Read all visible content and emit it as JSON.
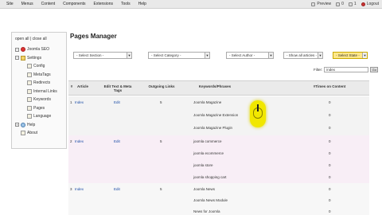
{
  "topbar": {
    "menu": [
      "Site",
      "Menus",
      "Content",
      "Components",
      "Extensions",
      "Tools",
      "Help"
    ],
    "preview": "Preview",
    "messages": "0",
    "users": "1",
    "logout": "Logout"
  },
  "sidebar": {
    "toggle": "open all | close all",
    "items": [
      {
        "label": "Joomla SEO"
      },
      {
        "label": "Settings"
      },
      {
        "label": "Config"
      },
      {
        "label": "MetaTags"
      },
      {
        "label": "Redirects"
      },
      {
        "label": "Internal Links"
      },
      {
        "label": "Keywords"
      },
      {
        "label": "Pages"
      },
      {
        "label": "Language"
      },
      {
        "label": "Help"
      },
      {
        "label": "About"
      }
    ]
  },
  "main": {
    "title": "Pages Manager",
    "filters": {
      "section": "- Select Section -",
      "category": "- Select Category -",
      "author": "- Select Author -",
      "articles": "- Show all articles -",
      "state": "- Select State -"
    },
    "filter_label": "Filter:",
    "filter_value": "index",
    "filter_button": "Go",
    "columns": {
      "num": "#",
      "article": "Article",
      "edit": "Edit Text & Meta Tags",
      "links": "Outgoing Links",
      "keywords": "Keywords/Phrases",
      "times": "#Times on Content"
    },
    "rows": [
      {
        "num": "1",
        "article": "Index",
        "edit": "Edit",
        "links": "5",
        "keywords": [
          {
            "kw": "Joomla Magazine",
            "times": "0"
          },
          {
            "kw": "Joomla Magazine Extension",
            "times": "0"
          },
          {
            "kw": "Joomla Magazine Plugin",
            "times": "0"
          }
        ]
      },
      {
        "num": "2",
        "article": "Index",
        "edit": "Edit",
        "links": "5",
        "keywords": [
          {
            "kw": "joomla commerce",
            "times": "0"
          },
          {
            "kw": "joomla ecommerce",
            "times": "0"
          },
          {
            "kw": "joomla store",
            "times": "0"
          },
          {
            "kw": "joomla shopping cart",
            "times": "0"
          }
        ]
      },
      {
        "num": "3",
        "article": "Index",
        "edit": "Edit",
        "links": "5",
        "keywords": [
          {
            "kw": "Joomla News",
            "times": "0"
          },
          {
            "kw": "Joomla News Module",
            "times": "0"
          },
          {
            "kw": "News for Joomla",
            "times": "0"
          }
        ]
      }
    ]
  },
  "colors": {
    "accent_highlight": "#f1e700",
    "link": "#1b4ca6",
    "state_select": "#ffe88a"
  }
}
